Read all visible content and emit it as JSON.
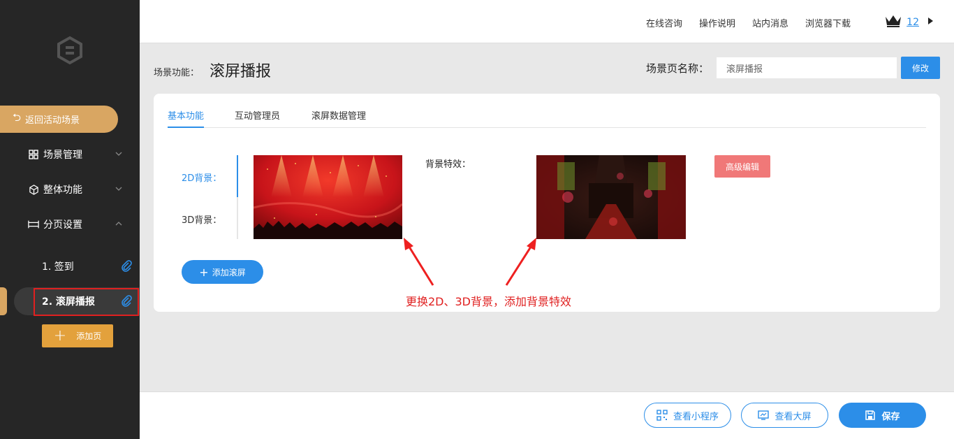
{
  "sidebar": {
    "back_label": "返回活动场景",
    "nav": [
      {
        "label": "场景管理"
      },
      {
        "label": "整体功能"
      },
      {
        "label": "分页设置"
      }
    ],
    "pages": [
      {
        "label": "1. 签到"
      },
      {
        "label": "2. 滚屏播报"
      }
    ],
    "add_page_label": "添加页"
  },
  "topbar": {
    "links": [
      "在线咨询",
      "操作说明",
      "站内消息",
      "浏览器下载"
    ],
    "vip_level": "12"
  },
  "header": {
    "scene_label": "场景功能：",
    "scene_title": "滚屏播报",
    "page_name_label": "场景页名称：",
    "page_name_value": "滚屏播报",
    "edit_label": "修改"
  },
  "card": {
    "tabs": [
      "基本功能",
      "互动管理员",
      "滚屏数据管理"
    ],
    "bg_2d_label": "2D背景：",
    "bg_3d_label": "3D背景：",
    "effect_label": "背景特效：",
    "advanced_edit_label": "高级编辑",
    "add_scroll_label": "添加滚屏"
  },
  "annotation": "更换2D、3D背景，添加背景特效",
  "bottombar": {
    "mini_program_label": "查看小程序",
    "big_screen_label": "查看大屏",
    "save_label": "保存"
  },
  "colors": {
    "accent": "#2c8ee8",
    "sidebar_bg": "#262626",
    "gold": "#d9a662",
    "annotation_red": "#e02020"
  }
}
